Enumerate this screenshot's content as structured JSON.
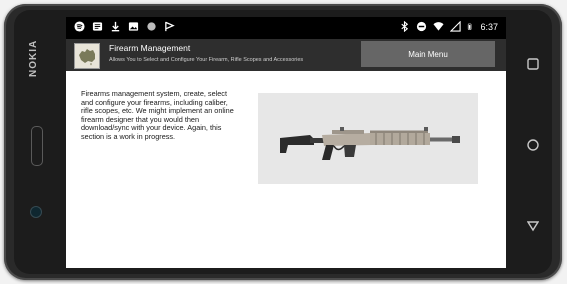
{
  "device": {
    "brand": "NOKIA"
  },
  "status_bar": {
    "time": "6:37"
  },
  "app_bar": {
    "title": "Firearm Management",
    "subtitle": "Allows You to Select and Configure Your Firearm, Rifle Scopes and Accessories",
    "main_menu_label": "Main Menu"
  },
  "content": {
    "description": "Firearms management system, create, select and configure your firearms, including caliber, rifle scopes, etc. We might implement an online firearm designer that you would then download/sync with your device. Again, this section is a work in progress.",
    "image_alt": "rifle"
  },
  "nav_buttons": [
    "square-recent-icon",
    "circle-home-icon",
    "triangle-back-icon"
  ]
}
